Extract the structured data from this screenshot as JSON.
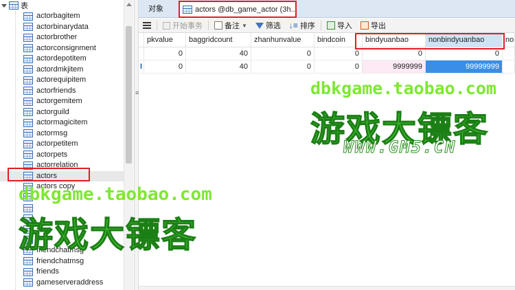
{
  "tree": {
    "root_label": "表",
    "items": [
      "actorbagitem",
      "actorbinarydata",
      "actorbrother",
      "actorconsignment",
      "actordepotitem",
      "actordmkjitem",
      "actorequipitem",
      "actorfriends",
      "actorgemitem",
      "actorguild",
      "actormagicitem",
      "actormsg",
      "actorpetitem",
      "actorpets",
      "actorrelation",
      "actors",
      "actors copy",
      "",
      "",
      "",
      "",
      "",
      "friendchatmsg",
      "friendchatmsg",
      "friends",
      "gameserveraddress"
    ],
    "selected_index": 15
  },
  "tabs": {
    "objects_label": "对象",
    "active_label": "actors @db_game_actor (3h..."
  },
  "toolbar": {
    "begin_tx": "开始事务",
    "note": "备注",
    "filter": "筛选",
    "sort": "排序",
    "import": "导入",
    "export": "导出"
  },
  "grid": {
    "columns": [
      "pkvalue",
      "baggridcount",
      "zhanhunvalue",
      "bindcoin",
      "bindyuanbao",
      "nonbindyuanbao",
      "no"
    ],
    "rows": [
      [
        "0",
        "40",
        "0",
        "0",
        "0",
        "0",
        ""
      ],
      [
        "0",
        "40",
        "0",
        "0",
        "9999999",
        "99999999",
        ""
      ]
    ],
    "row_marker": "I"
  },
  "watermark": {
    "url": "dbkgame.taobao.com",
    "brand": "游戏大镖客",
    "site": "WWW.GM5.CN"
  },
  "colors": {
    "highlight_red": "#e41b23",
    "selected_cell": "#3a8ee6",
    "pink_cell": "#fdeaf5",
    "watermark_green": "#4ed63a"
  }
}
